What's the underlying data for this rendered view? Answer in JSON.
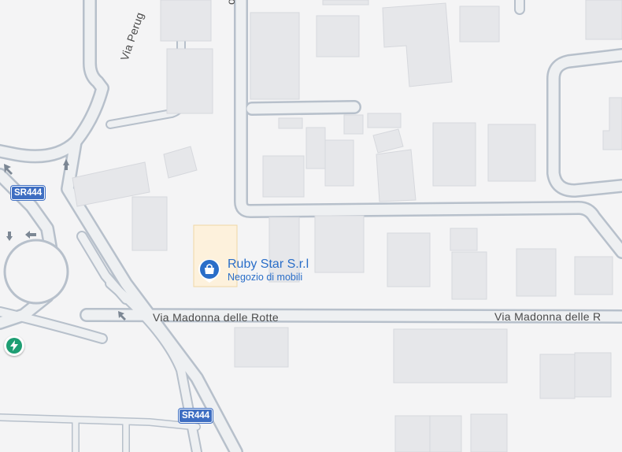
{
  "colors": {
    "background": "#f4f4f5",
    "building_fill": "#e6e7ea",
    "building_stroke": "#d6d8dd",
    "road_casing": "#b7c0cb",
    "road_fill": "#eef0f2",
    "highlight_fill": "#fdf1dc",
    "highlight_stroke": "#f0d6a5",
    "poi_blue": "#2a6ec8",
    "shield_blue": "#3e6ec2",
    "ev_green": "#1e9e73"
  },
  "roads": {
    "via_perugia": "Via Perug",
    "via_madonna_left": "Via Madonna delle Rotte",
    "via_madonna_right": "Via Madonna delle R",
    "road_shield_1": "SR444",
    "road_shield_2": "SR444"
  },
  "poi": {
    "name": "Ruby Star S.r.l",
    "category": "Negozio di mobili",
    "icon": "shopping-bag-icon"
  },
  "ev_station": {
    "icon": "lightning-bolt-icon"
  },
  "arrows": {
    "icon": "one-way-arrow-icon"
  }
}
